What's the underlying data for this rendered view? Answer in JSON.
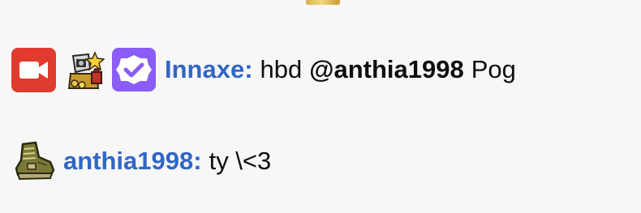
{
  "colors": {
    "background": "#f7f7f8",
    "username": "#3066c4",
    "text": "#0e0e10",
    "video_badge": "#e03b2e",
    "verified_badge": "#8b5cf6"
  },
  "messages": [
    {
      "badges": [
        "video-camera-icon",
        "gift-bag-icon",
        "verified-icon"
      ],
      "username": "Innaxe:",
      "text_before_mention": "hbd",
      "mention": "@anthia1998",
      "text_after_mention": "Pog"
    },
    {
      "badges": [
        "boot-icon"
      ],
      "username": "anthia1998:",
      "text": "ty \\<3"
    }
  ]
}
